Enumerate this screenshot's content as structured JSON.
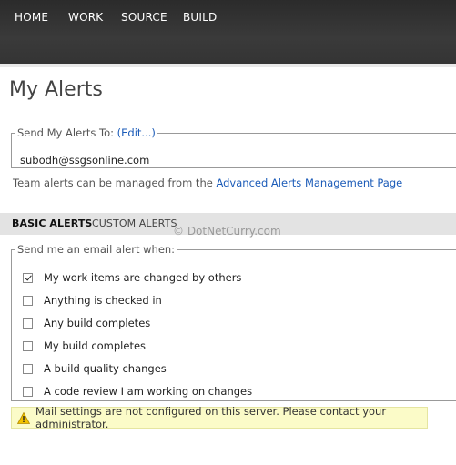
{
  "nav": {
    "items": [
      "HOME",
      "WORK",
      "SOURCE",
      "BUILD"
    ]
  },
  "page": {
    "title": "My Alerts"
  },
  "send_alerts": {
    "legend": "Send My Alerts To: ",
    "edit_link": "(Edit...)",
    "email": "subodh@ssgsonline.com"
  },
  "team_note": {
    "text": "Team alerts can be managed from the ",
    "link": "Advanced Alerts Management Page"
  },
  "tabs": [
    {
      "label": "BASIC ALERTS",
      "active": true
    },
    {
      "label": "CUSTOM ALERTS",
      "active": false
    }
  ],
  "watermark": "© DotNetCurry.com",
  "alerts": {
    "legend": "Send me an email alert when:",
    "options": [
      {
        "label": "My work items are changed by others",
        "checked": true
      },
      {
        "label": "Anything is checked in",
        "checked": false
      },
      {
        "label": "Any build completes",
        "checked": false
      },
      {
        "label": "My build completes",
        "checked": false
      },
      {
        "label": "A build quality changes",
        "checked": false
      },
      {
        "label": "A code review I am working on changes",
        "checked": false
      }
    ]
  },
  "warning": {
    "icon": "warning-icon",
    "text": "Mail settings are not configured on this server. Please contact your administrator."
  },
  "colors": {
    "link": "#1b5bb8",
    "nav_background": "#333333",
    "warning_background": "#fbfbc8"
  }
}
